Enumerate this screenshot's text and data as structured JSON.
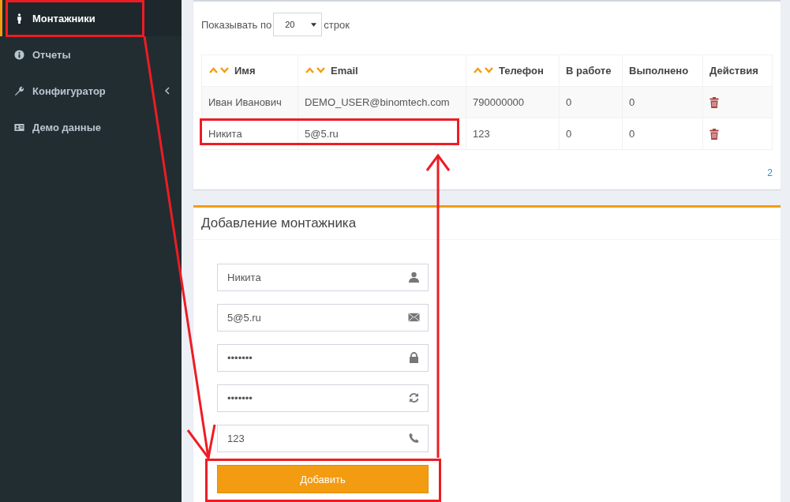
{
  "sidebar": {
    "items": [
      {
        "label": "Монтажники",
        "kind": "person",
        "selected": true,
        "has_submenu": false
      },
      {
        "label": "Отчеты",
        "kind": "info",
        "selected": false,
        "has_submenu": false
      },
      {
        "label": "Конфигуратор",
        "kind": "wrench",
        "selected": false,
        "has_submenu": true
      },
      {
        "label": "Демо данные",
        "kind": "card",
        "selected": false,
        "has_submenu": false
      }
    ]
  },
  "page_size": {
    "before": "Показывать по",
    "value": "20",
    "after": "строк"
  },
  "table": {
    "columns": [
      {
        "label": "Имя",
        "sortable": true
      },
      {
        "label": "Email",
        "sortable": true
      },
      {
        "label": "Телефон",
        "sortable": true
      },
      {
        "label": "В работе",
        "sortable": false
      },
      {
        "label": "Выполнено",
        "sortable": false
      },
      {
        "label": "Действия",
        "sortable": false
      }
    ],
    "rows": [
      {
        "cells": [
          "Иван Иванович",
          "DEMO_USER@binomtech.com",
          "790000000",
          "0",
          "0"
        ]
      },
      {
        "cells": [
          "Никита",
          "5@5.ru",
          "123",
          "0",
          "0"
        ]
      }
    ]
  },
  "pagination": [
    "2"
  ],
  "form": {
    "title": "Добавление монтажника",
    "fields": [
      {
        "value": "Никита",
        "kind": "user"
      },
      {
        "value": "5@5.ru",
        "kind": "envelope"
      },
      {
        "value": "•••••••",
        "kind": "lock"
      },
      {
        "value": "•••••••",
        "kind": "refresh"
      },
      {
        "value": "123",
        "kind": "phone"
      }
    ],
    "submit": "Добавить"
  }
}
